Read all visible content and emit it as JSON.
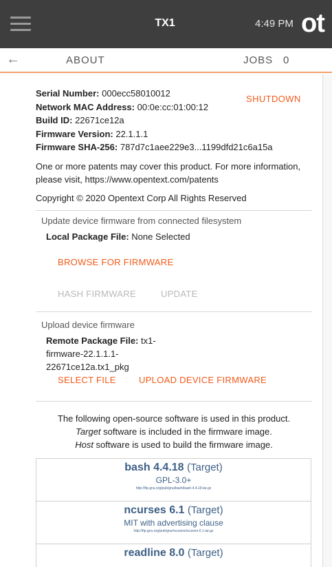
{
  "header": {
    "menu_icon": "hamburger-menu-icon",
    "device_name": "TX1",
    "time": "4:49 PM",
    "logo_text": "ot"
  },
  "tabs": {
    "back_icon": "back-arrow-icon",
    "back_glyph": "←",
    "about_label": "ABOUT",
    "jobs_label": "JOBS",
    "jobs_count": "0"
  },
  "about": {
    "serial_label": "Serial Number:",
    "serial_value": "000ecc58010012",
    "mac_label": "Network MAC Address:",
    "mac_value": "00:0e:cc:01:00:12",
    "build_label": "Build ID:",
    "build_value": "22671ce12a",
    "fw_version_label": "Firmware Version:",
    "fw_version_value": "22.1.1.1",
    "fw_sha_label": "Firmware SHA-256:",
    "fw_sha_value": "787d7c1aee229e3...1199dfd21c6a15a",
    "shutdown_label": "SHUTDOWN",
    "patents_text": "One or more patents may cover this product. For more information, please visit, https://www.opentext.com/patents",
    "copyright_text": "Copyright © 2020 Opentext Corp All Rights Reserved"
  },
  "local_update": {
    "title": "Update device firmware from connected filesystem",
    "file_label": "Local Package File:",
    "file_value": "None Selected",
    "browse_label": "BROWSE FOR FIRMWARE",
    "hash_label": "HASH FIRMWARE",
    "update_label": "UPDATE"
  },
  "remote_upload": {
    "title": "Upload device firmware",
    "file_label": "Remote Package File:",
    "file_value": "tx1-firmware-22.1.1.1-22671ce12a.tx1_pkg",
    "select_label": "SELECT FILE",
    "upload_label": "UPLOAD DEVICE FIRMWARE"
  },
  "oss": {
    "intro_line1": "The following open-source software is used in this product.",
    "target_word": "Target",
    "intro_line2_rest": " software is included in the firmware image.",
    "host_word": "Host",
    "intro_line3_rest": " software is used to build the firmware image.",
    "packages": [
      {
        "name": "bash 4.4.18",
        "type": "(Target)",
        "license": "GPL-3.0+",
        "url": "http://ftp.gnu.org/pub/gnu/bash/bash-4.4.18.tar.gz"
      },
      {
        "name": "ncurses 6.1",
        "type": "(Target)",
        "license": "MIT with advertising clause",
        "url": "http://ftp.gnu.org/pub/gnu/ncurses/ncurses-6.1.tar.gz"
      },
      {
        "name": "readline 8.0",
        "type": "(Target)",
        "license": "",
        "url": ""
      }
    ]
  },
  "colors": {
    "accent": "#f05a1a",
    "header_bg": "#3e3e3e",
    "link_blue": "#3d5f86"
  }
}
